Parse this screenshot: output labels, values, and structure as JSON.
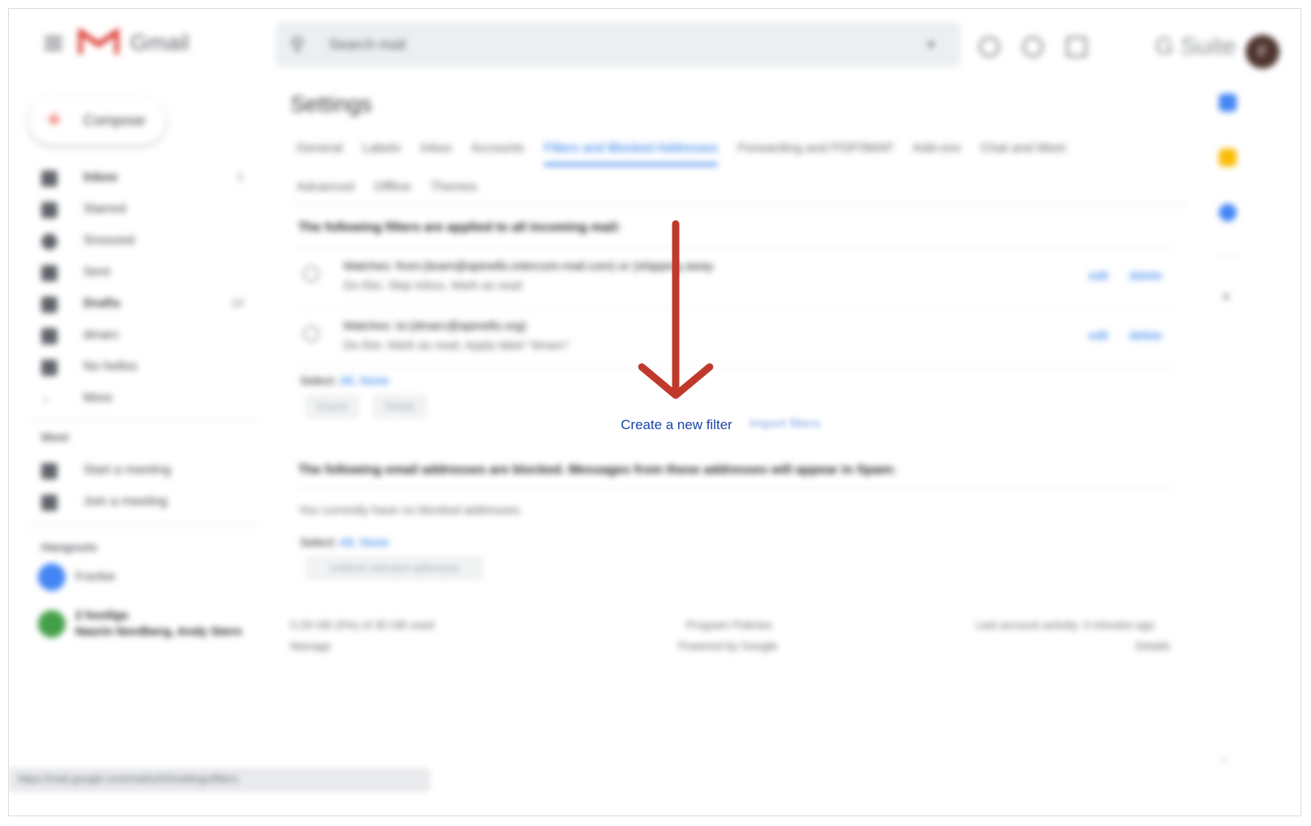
{
  "app": {
    "logo_text": "Gmail",
    "brand": "G Suite",
    "avatar_initial": "F"
  },
  "search": {
    "placeholder": "Search mail"
  },
  "compose": {
    "label": "Compose"
  },
  "sidebar": {
    "items": [
      {
        "label": "Inbox",
        "count": "1",
        "bold": true
      },
      {
        "label": "Starred",
        "count": "",
        "bold": false
      },
      {
        "label": "Snoozed",
        "count": "",
        "bold": false
      },
      {
        "label": "Sent",
        "count": "",
        "bold": false
      },
      {
        "label": "Drafts",
        "count": "14",
        "bold": true
      },
      {
        "label": "dmarc",
        "count": "",
        "bold": false
      },
      {
        "label": "No hellos",
        "count": "",
        "bold": false
      },
      {
        "label": "More",
        "count": "",
        "bold": false
      }
    ],
    "meet": {
      "heading": "Meet",
      "items": [
        "Start a meeting",
        "Join a meeting"
      ]
    },
    "hangouts": {
      "heading": "Hangouts",
      "user": "Frankie",
      "group_title": "2 hooligs",
      "group_members": "Nasrin Nordberg, Andy Stern"
    }
  },
  "settings": {
    "title": "Settings",
    "tabs_row1": [
      "General",
      "Labels",
      "Inbox",
      "Accounts",
      "Filters and Blocked Addresses",
      "Forwarding and POP/IMAP",
      "Add-ons",
      "Chat and Meet"
    ],
    "tabs_row2": [
      "Advanced",
      "Offline",
      "Themes"
    ],
    "active_tab": "Filters and Blocked Addresses",
    "filters_heading": "The following filters are applied to all incoming mail:",
    "filters": [
      {
        "matches": "Matches: from:(team@apinello.intercom-mail.com) or (shipping away",
        "action": "Do this: Skip Inbox, Mark as read",
        "edit": "edit",
        "delete": "delete"
      },
      {
        "matches": "Matches: to:(dmarc@apinello.org)",
        "action": "Do this: Mark as read, Apply label \"dmarc\"",
        "edit": "edit",
        "delete": "delete"
      }
    ],
    "select_label": "Select:",
    "select_all": "All,",
    "select_none": "None",
    "export_btn": "Export",
    "delete_btn": "Delete",
    "create_filter": "Create a new filter",
    "import_filters": "Import filters",
    "blocked_heading": "The following email addresses are blocked. Messages from these addresses will appear in Spam:",
    "no_blocked": "You currently have no blocked addresses.",
    "unblock_btn": "Unblock selected addresses"
  },
  "footer": {
    "storage": "0.29 GB (0%) of 30 GB used",
    "manage": "Manage",
    "policies": "Program Policies",
    "powered": "Powered by Google",
    "activity": "Last account activity: 0 minutes ago",
    "details": "Details"
  },
  "status_url": "https://mail.google.com/mail/u/0/#settings/filters",
  "colors": {
    "accent": "#1a73e8",
    "arrow": "#c0392b",
    "link": "#1a45a8"
  }
}
